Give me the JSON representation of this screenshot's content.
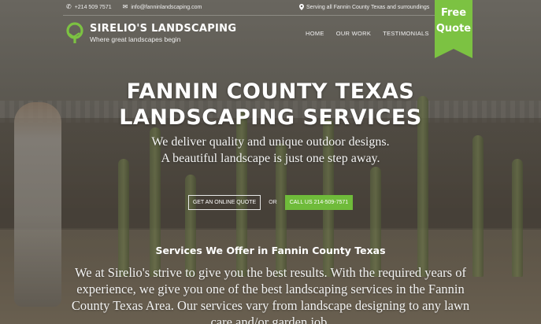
{
  "topbar": {
    "phone": "+214 509 7571",
    "email": "info@fanninlandscaping.com",
    "service_area": "Serving all Fannin County Texas and surroundings"
  },
  "brand": {
    "name": "SIRELIO'S LANDSCAPING",
    "tagline": "Where great landscapes begin",
    "accent_color": "#7cc242"
  },
  "nav": {
    "items": [
      {
        "label": "HOME"
      },
      {
        "label": "OUR WORK"
      },
      {
        "label": "TESTIMONIALS"
      }
    ]
  },
  "free_quote": {
    "line1": "Free",
    "line2": "Quote"
  },
  "hero": {
    "title_line1": "FANNIN COUNTY TEXAS",
    "title_line2": "LANDSCAPING SERVICES",
    "subtitle_line1": "We deliver quality and unique outdoor designs.",
    "subtitle_line2": "A beautiful landscape is just one step away.",
    "cta_quote": "GET AN ONLINE QUOTE",
    "cta_or": "OR",
    "cta_call": "CALL US 214-509-7571"
  },
  "services": {
    "title": "Services We Offer in Fannin County Texas",
    "text": "We at Sirelio's strive to give you the best results. With the required years of experience, we give you one of the best landscaping services in the Fannin County Texas Area. Our services vary from landscape designing to any lawn care and/or garden job."
  },
  "icons": {
    "phone": "phone-icon",
    "email": "envelope-icon",
    "location": "map-pin-icon",
    "logo": "tree-logo-icon"
  }
}
